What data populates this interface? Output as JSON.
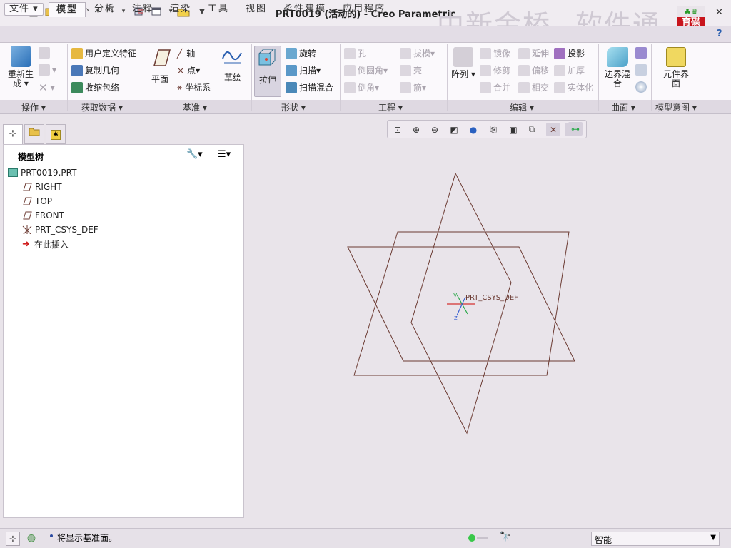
{
  "window": {
    "title": "PRT0019 (活动的) - Creo Parametric",
    "watermark_left": "中新金桥",
    "watermark_right": "软件通",
    "logo_line1": "育碟",
    "logo_line2": "软件"
  },
  "tabs": [
    {
      "label": "文件",
      "file": true
    },
    {
      "label": "模型",
      "active": true
    },
    {
      "label": "分析"
    },
    {
      "label": "注释"
    },
    {
      "label": "渲染"
    },
    {
      "label": "工具"
    },
    {
      "label": "视图"
    },
    {
      "label": "柔性建模"
    },
    {
      "label": "应用程序"
    }
  ],
  "ribbon": {
    "regenerate": "重新生成",
    "user_defined_feature": "用户定义特征",
    "copy_geometry": "复制几何",
    "shrinkwrap": "收缩包络",
    "plane": "平面",
    "axis": "轴",
    "point": "点",
    "csys": "坐标系",
    "sketch": "草绘",
    "extrude": "拉伸",
    "revolve": "旋转",
    "sweep": "扫描",
    "swept_blend": "扫描混合",
    "hole": "孔",
    "round": "倒圆角",
    "chamfer": "倒角",
    "draft": "拔模",
    "shell": "壳",
    "rib": "筋",
    "pattern": "阵列",
    "mirror": "镜像",
    "trim": "修剪",
    "merge": "合并",
    "extend": "延伸",
    "offset": "偏移",
    "intersect": "相交",
    "project": "投影",
    "thicken": "加厚",
    "solidify": "实体化",
    "boundary_blend": "边界混合",
    "component_interface": "元件界面"
  },
  "groups": [
    "操作",
    "获取数据",
    "基准",
    "形状",
    "工程",
    "编辑",
    "曲面",
    "模型意图"
  ],
  "model_tree": {
    "title": "模型树",
    "items": [
      "PRT0019.PRT",
      "RIGHT",
      "TOP",
      "FRONT",
      "PRT_CSYS_DEF",
      "在此插入"
    ]
  },
  "canvas": {
    "csys_label": "PRT_CSYS_DEF",
    "axis_x": "x",
    "axis_y": "y",
    "axis_z": "z"
  },
  "status": {
    "message": "将显示基准面。",
    "filter": "智能"
  },
  "colors": {
    "datum_plane": "#6b3a32",
    "csys_red": "#d43030",
    "csys_green": "#2aa84a",
    "csys_blue": "#3a60d0"
  }
}
